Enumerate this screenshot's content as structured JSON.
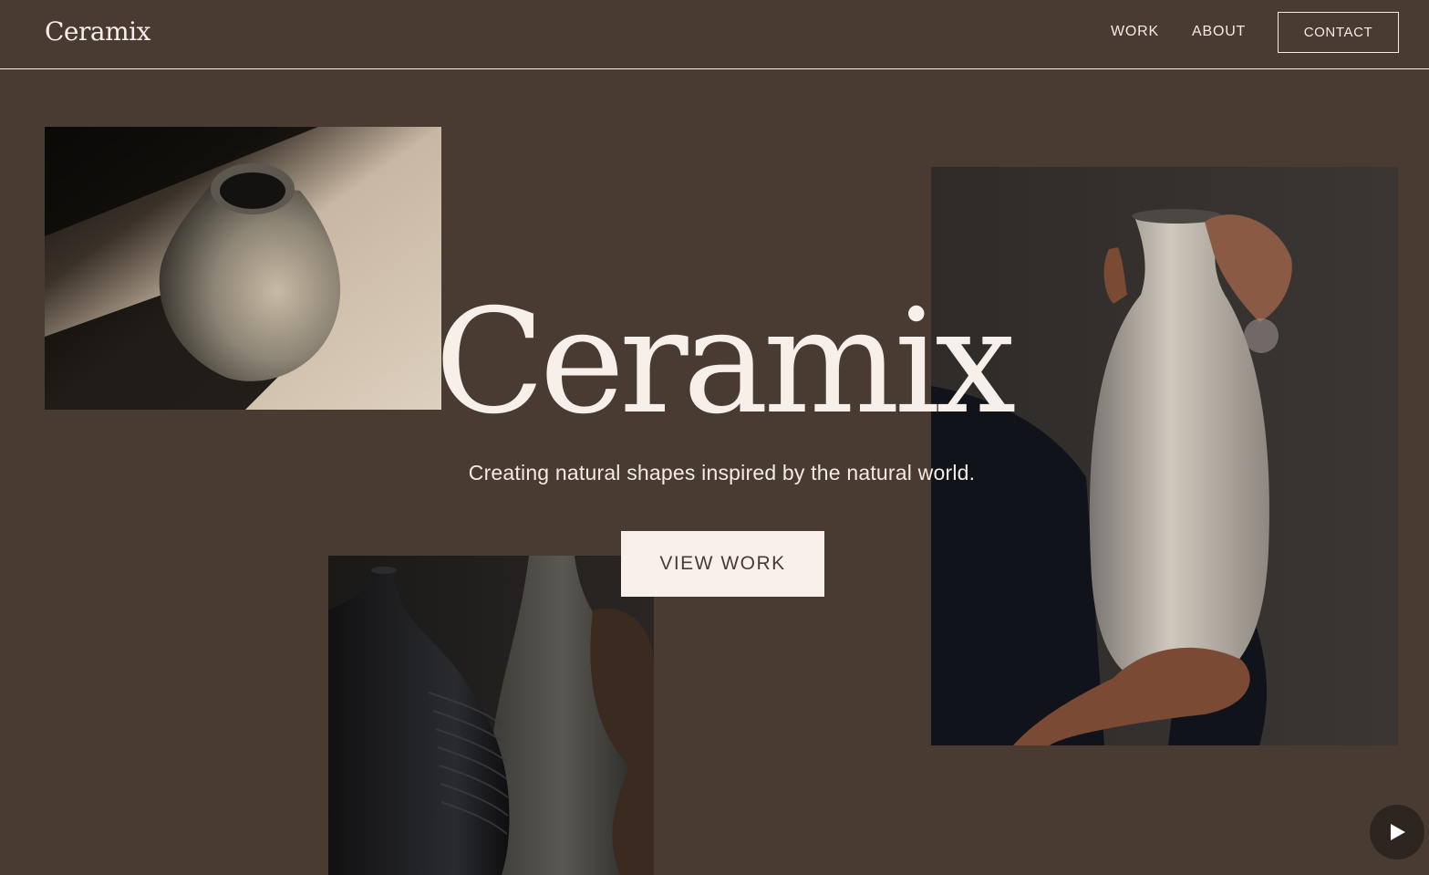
{
  "header": {
    "logo": "Ceramix",
    "nav": [
      {
        "label": "WORK"
      },
      {
        "label": "ABOUT"
      }
    ],
    "contact_label": "CONTACT"
  },
  "hero": {
    "title": "Ceramix",
    "subtitle": "Creating natural shapes inspired by the natural world.",
    "cta_label": "VIEW WORK"
  },
  "images": [
    {
      "name": "round-vase-in-sunlight"
    },
    {
      "name": "hand-holding-speckled-vase"
    },
    {
      "name": "dark-ribbed-vases"
    }
  ],
  "icons": {
    "play": "play-icon"
  },
  "colors": {
    "background": "#493b32",
    "text": "#f3ebe6",
    "button_bg": "#f8f0eb",
    "button_text": "#4a3c33"
  }
}
